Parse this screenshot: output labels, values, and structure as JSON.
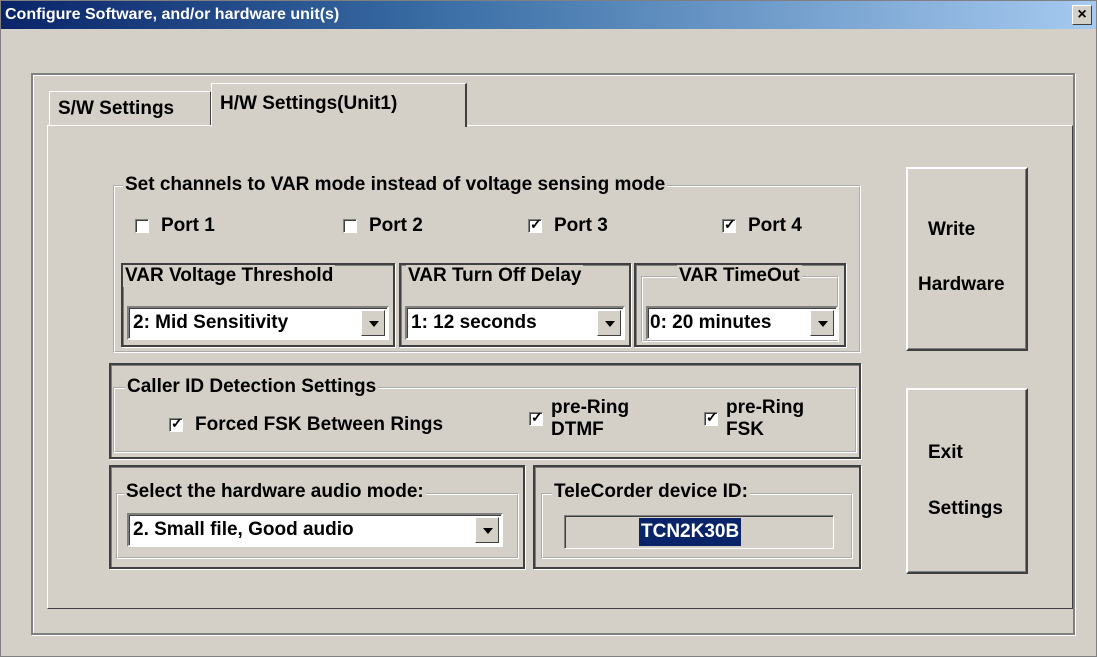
{
  "window": {
    "title": "Configure Software, and/or hardware unit(s)",
    "close_glyph": "×"
  },
  "tabs": [
    {
      "label": "S/W Settings",
      "selected": false
    },
    {
      "label": "H/W Settings(Unit1)",
      "selected": true
    }
  ],
  "var_mode": {
    "legend": "Set channels to VAR mode instead of voltage sensing mode",
    "ports": [
      {
        "label": "Port 1",
        "checked": false
      },
      {
        "label": "Port 2",
        "checked": false
      },
      {
        "label": "Port 3",
        "checked": true
      },
      {
        "label": "Port 4",
        "checked": true
      }
    ],
    "threshold": {
      "legend": "VAR Voltage Threshold",
      "value": "2: Mid Sensitivity"
    },
    "turn_off_delay": {
      "legend": "VAR Turn Off Delay",
      "value": "1: 12 seconds"
    },
    "timeout": {
      "legend": "VAR TimeOut",
      "value": "0: 20 minutes"
    }
  },
  "caller_id": {
    "legend": "Caller ID Detection Settings",
    "forced_fsk": {
      "label": "Forced FSK Between Rings",
      "checked": true
    },
    "pre_ring_dtmf": {
      "line1": "pre-Ring",
      "line2": "DTMF",
      "checked": true
    },
    "pre_ring_fsk": {
      "line1": "pre-Ring",
      "line2": "FSK",
      "checked": true
    }
  },
  "audio_mode": {
    "legend": "Select the hardware audio mode:",
    "value": "2. Small file, Good audio"
  },
  "device_id": {
    "legend": "TeleCorder device ID:",
    "value": "TCN2K30B"
  },
  "buttons": {
    "write_line1": "Write",
    "write_line2": "Hardware",
    "exit_line1": "Exit",
    "exit_line2": "Settings"
  }
}
